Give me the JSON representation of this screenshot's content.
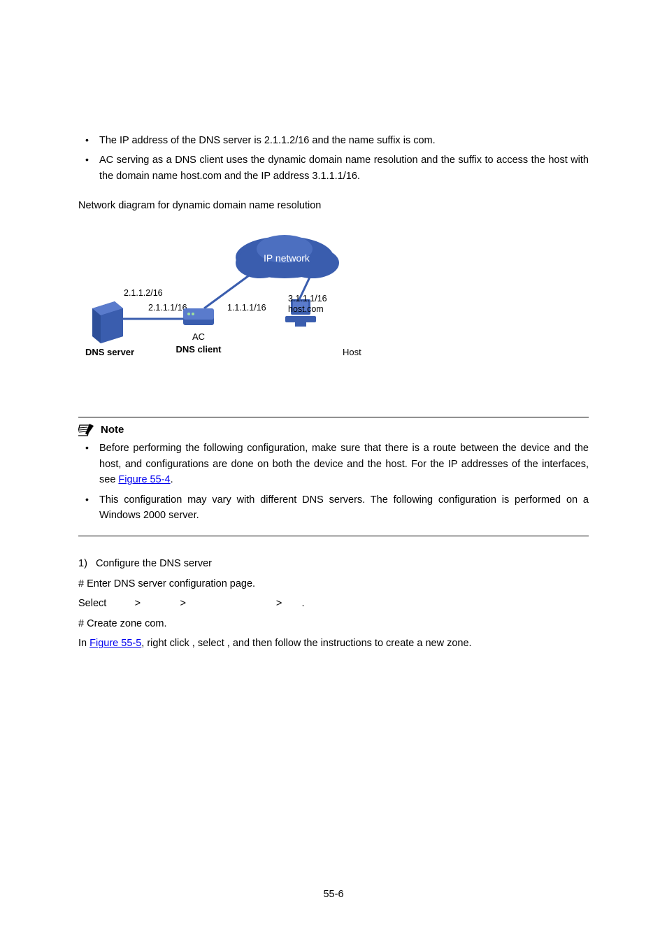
{
  "bullets_top": [
    "The IP address of the DNS server is 2.1.1.2/16 and the name suffix is com.",
    "AC serving as a DNS client uses the dynamic domain name resolution and the suffix to access the host with the domain name host.com and the IP address 3.1.1.1/16."
  ],
  "figure_caption": "Network diagram for dynamic domain name resolution",
  "diagram": {
    "cloud_label": "IP network",
    "dns_server_ip": "2.1.1.2/16",
    "ac_left_ip": "2.1.1.1/16",
    "ac_right_ip": "1.1.1.1/16",
    "host_ip": "3.1.1.1/16",
    "host_domain": "host.com",
    "dns_server_label": "DNS server",
    "ac_label_top": "AC",
    "ac_label_bottom": "DNS client",
    "host_label": "Host"
  },
  "note_label": "Note",
  "note_bullets": [
    {
      "pre": "Before performing the following configuration, make sure that there is a route between the device and the host, and configurations are done on both the device and the host. For the IP addresses of the interfaces, see ",
      "link": "Figure 55-4",
      "post": "."
    },
    {
      "pre": "This configuration may vary with different DNS servers. The following configuration is performed on a Windows 2000 server.",
      "link": "",
      "post": ""
    }
  ],
  "step_number": "1)",
  "step_text": "Configure the DNS server",
  "enter_line": "# Enter DNS server configuration page.",
  "select_line": "Select          >              >                                >       .",
  "create_zone": "# Create zone com.",
  "right_click": {
    "pre": "In ",
    "link": "Figure 55-5",
    "mid1": ", right click                                         , select                    , and then follow the instructions to create a new zone."
  },
  "page_number": "55-6"
}
